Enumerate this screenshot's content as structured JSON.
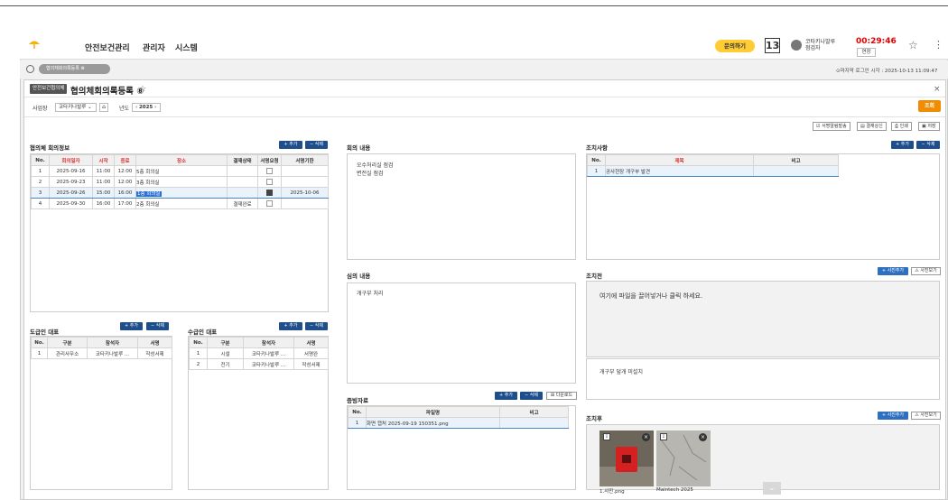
{
  "header": {
    "title": "안전보건관리",
    "menu": [
      "관리자",
      "시스템"
    ],
    "inquiry_label": "문의하기",
    "calendar_day": "13",
    "user_line1": "코타키나발루",
    "user_line2": "점검자",
    "timer": "00:29:46",
    "extend_label": "연장"
  },
  "tab": {
    "label": "협의체회의록등록 ⊗",
    "last_login": "⊙마지막 로그인 시각 : 2025-10-13 11:09:47"
  },
  "page": {
    "badge": "안전보건협의체",
    "title": "협의체회의록등록 ⑧"
  },
  "filter": {
    "site_label": "사업장",
    "site_value": "코타키나발루",
    "year_label": "년도",
    "year_value": "2025",
    "search_label": "조회"
  },
  "actions": [
    "서명알림발송",
    "결재상신",
    "인쇄",
    "저장"
  ],
  "meeting": {
    "title": "협의체 회의정보",
    "add": "+ 추가",
    "del": "− 삭제",
    "headers": [
      "No.",
      "회의일자",
      "시작",
      "종료",
      "장소",
      "결재상태",
      "서명요청",
      "서명기한"
    ],
    "rows": [
      {
        "no": "1",
        "date": "2025-09-16",
        "start": "11:00",
        "end": "12:00",
        "place": "5층 회의실",
        "status": "",
        "deadline": ""
      },
      {
        "no": "2",
        "date": "2025-09-23",
        "start": "11:00",
        "end": "12:00",
        "place": "3층 회의실",
        "status": "",
        "deadline": ""
      },
      {
        "no": "3",
        "date": "2025-09-26",
        "start": "15:00",
        "end": "16:00",
        "place": "1층 회의실",
        "status": "",
        "deadline": "2025-10-06"
      },
      {
        "no": "4",
        "date": "2025-09-30",
        "start": "16:00",
        "end": "17:00",
        "place": "2층 회의실",
        "status": "결재완료",
        "deadline": ""
      }
    ]
  },
  "contractor": {
    "title": "도급인 대표",
    "add": "+ 추가",
    "del": "− 삭제",
    "headers": [
      "No.",
      "구분",
      "참석자",
      "서명"
    ],
    "rows": [
      {
        "no": "1",
        "type": "관리사무소",
        "attendee": "코타키나발루 ...",
        "sign": "작성서제"
      }
    ]
  },
  "subcontractor": {
    "title": "수급인 대표",
    "add": "+ 추가",
    "del": "− 삭제",
    "headers": [
      "No.",
      "구분",
      "참석자",
      "서명"
    ],
    "rows": [
      {
        "no": "1",
        "type": "시설",
        "attendee": "코타키나발루 ...",
        "sign": "서명완"
      },
      {
        "no": "2",
        "type": "전기",
        "attendee": "코타키나발루 ...",
        "sign": "작성서제"
      }
    ]
  },
  "minutes": {
    "title": "회의 내용",
    "lines": [
      "오수처리실 점검",
      "변전실 점검"
    ]
  },
  "review": {
    "title": "심의 내용",
    "text": "개구부 처리"
  },
  "evidence": {
    "title": "증빙자료",
    "add": "+ 추가",
    "del": "− 삭제",
    "download": "다운로드",
    "headers": [
      "No.",
      "파일명",
      "비고"
    ],
    "rows": [
      {
        "no": "1",
        "file": "화면 캡처 2025-09-19 150351.png",
        "note": ""
      }
    ]
  },
  "measures": {
    "title": "조치사항",
    "add": "+ 추가",
    "del": "− 삭제",
    "headers": [
      "No.",
      "제목",
      "비고"
    ],
    "rows": [
      {
        "no": "1",
        "title": "공사현장 개구부 발견",
        "note": ""
      }
    ]
  },
  "before": {
    "title": "조치전",
    "add_photo": "사진추가",
    "view_photo": "사진보기",
    "drop_text": "여기에 파일을 끌어넣거나 클릭 하세요.",
    "desc": "개구부 덮개 미설치"
  },
  "after": {
    "title": "조치후",
    "add_photo": "사진추가",
    "view_photo": "사진보기",
    "cap1": "1.사진.png",
    "cap2": "Maintech 2025"
  }
}
